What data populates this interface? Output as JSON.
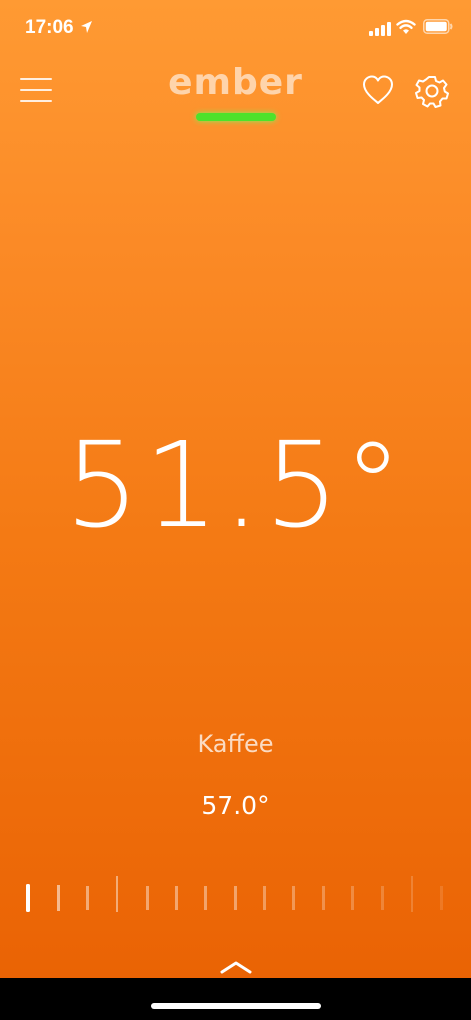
{
  "status_bar": {
    "time": "17:06",
    "icons": [
      "location-arrow-icon",
      "signal-bars-icon",
      "wifi-icon",
      "battery-icon"
    ]
  },
  "header": {
    "brand": "ember",
    "connection_color": "#4de22b",
    "icons": [
      "hamburger-menu-icon",
      "heart-icon",
      "gear-icon"
    ]
  },
  "main": {
    "current_temperature": "51.5°",
    "preset_name": "Kaffee",
    "target_temperature": "57.0°"
  },
  "slider": {
    "icon": "temperature-scale-slider"
  },
  "footer": {
    "expand_icon": "chevron-up-icon"
  },
  "colors": {
    "accent_top": "#ff9a33",
    "accent_bottom": "#ea6304",
    "text": "#ffffff"
  }
}
